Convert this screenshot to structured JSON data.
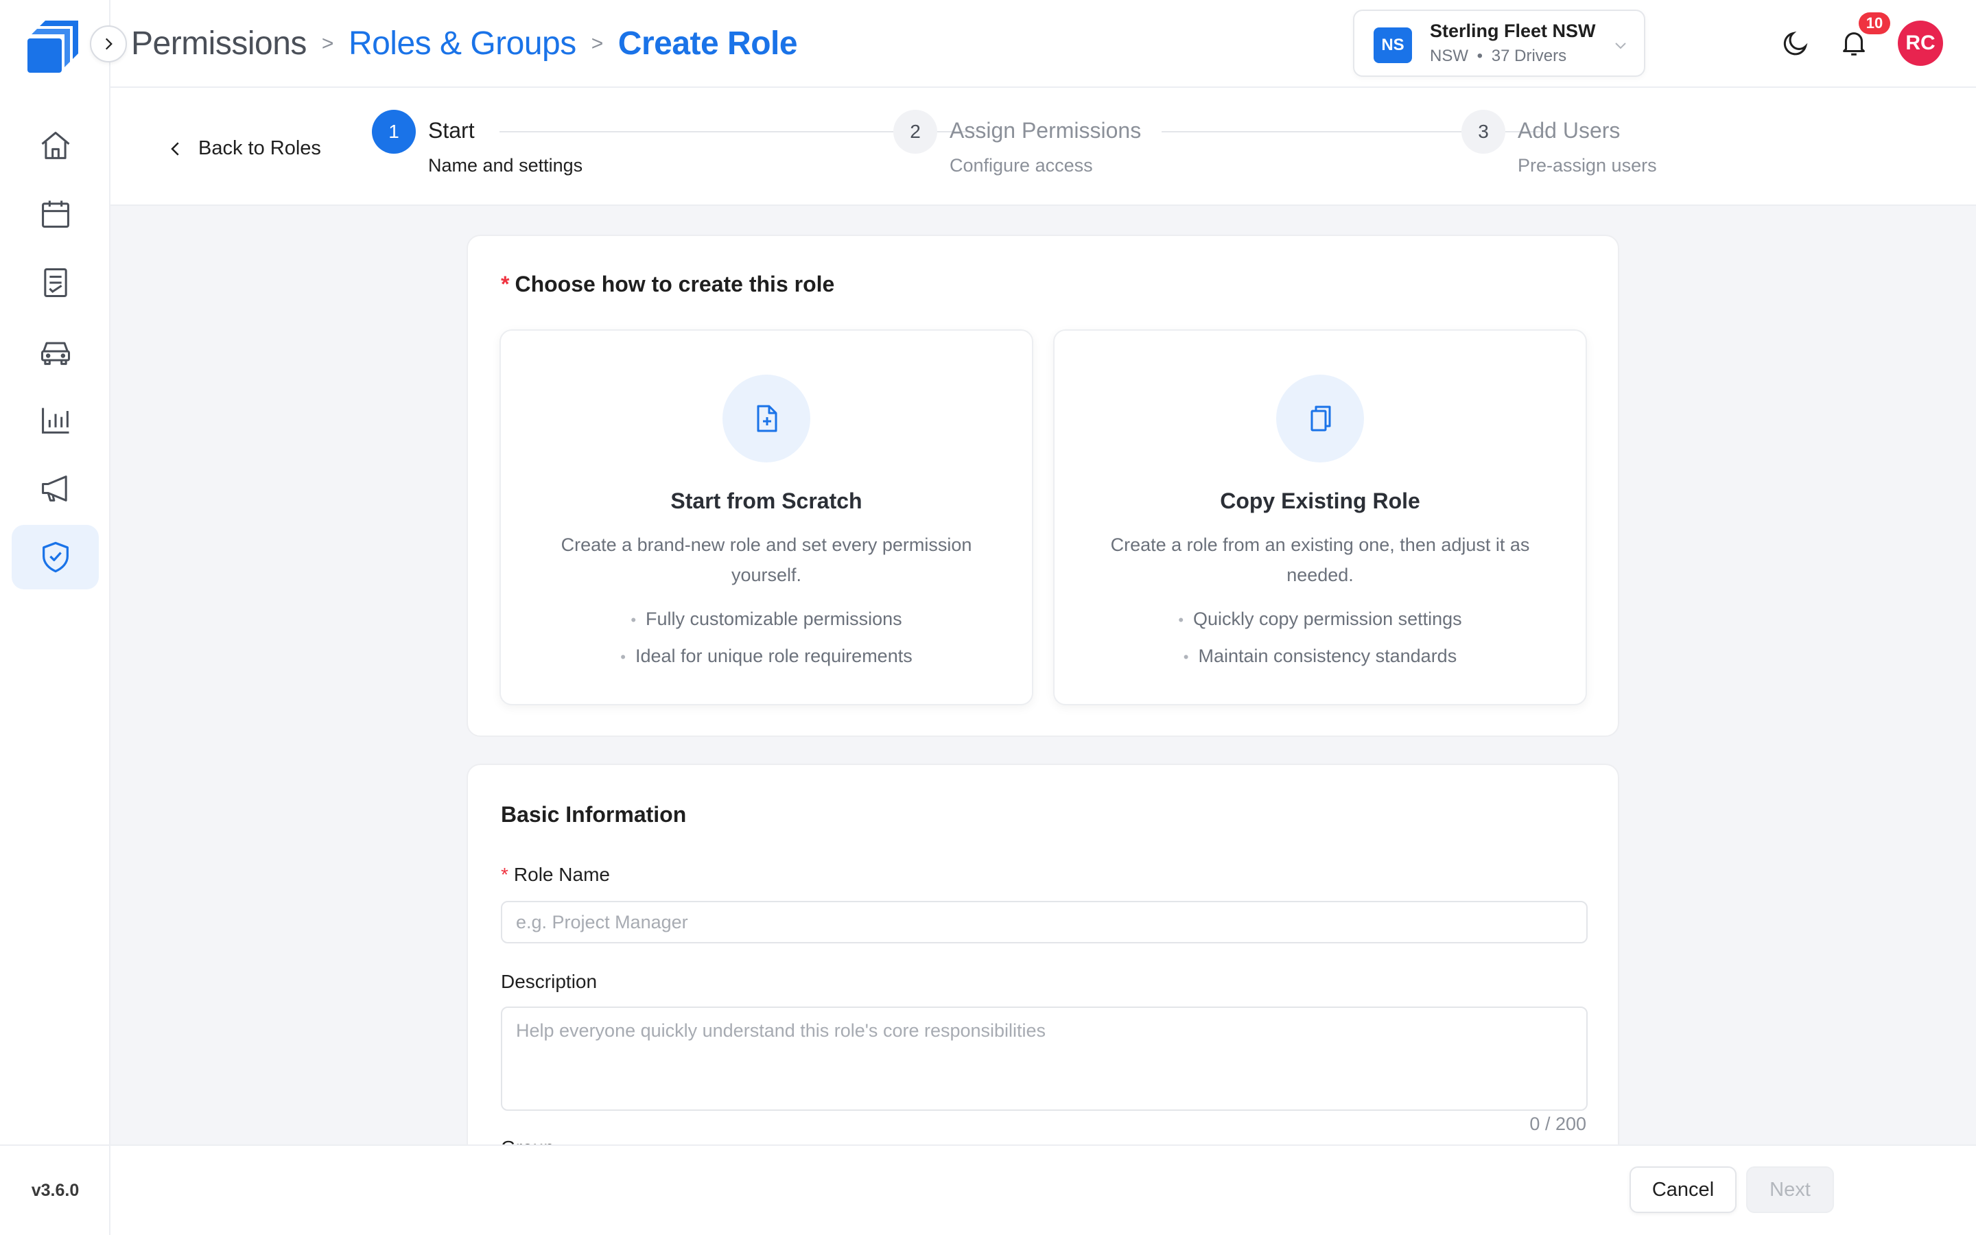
{
  "app": {
    "version": "v3.6.0"
  },
  "breadcrumb": {
    "items": [
      "Permissions",
      "Roles & Groups",
      "Create Role"
    ],
    "separator": ">"
  },
  "org": {
    "initials": "NS",
    "name": "Sterling Fleet NSW",
    "region": "NSW",
    "meta_sep": "•",
    "drivers": "37 Drivers"
  },
  "notifications": {
    "count": "10"
  },
  "user": {
    "initials": "RC"
  },
  "sidebar": {
    "items": [
      {
        "name": "home",
        "icon": "home-icon",
        "active": false
      },
      {
        "name": "calendar",
        "icon": "calendar-icon",
        "active": false
      },
      {
        "name": "documents",
        "icon": "document-list-icon",
        "active": false
      },
      {
        "name": "vehicles",
        "icon": "car-icon",
        "active": false
      },
      {
        "name": "reports",
        "icon": "bar-chart-icon",
        "active": false
      },
      {
        "name": "announcements",
        "icon": "megaphone-icon",
        "active": false
      },
      {
        "name": "permissions",
        "icon": "shield-check-icon",
        "active": true
      }
    ]
  },
  "stepper": {
    "back_label": "Back to Roles",
    "steps": [
      {
        "num": "1",
        "title": "Start",
        "subtitle": "Name and settings",
        "active": true
      },
      {
        "num": "2",
        "title": "Assign Permissions",
        "subtitle": "Configure access",
        "active": false
      },
      {
        "num": "3",
        "title": "Add Users",
        "subtitle": "Pre-assign users",
        "active": false
      }
    ]
  },
  "creation": {
    "required_mark": "*",
    "title": "Choose how to create this role",
    "options": [
      {
        "icon": "file-plus-icon",
        "title": "Start from Scratch",
        "description": "Create a brand-new role and set every permission yourself.",
        "bullets": [
          "Fully customizable permissions",
          "Ideal for unique role requirements"
        ]
      },
      {
        "icon": "copy-icon",
        "title": "Copy Existing Role",
        "description": "Create a role from an existing one, then adjust it as needed.",
        "bullets": [
          "Quickly copy permission settings",
          "Maintain consistency standards"
        ]
      }
    ]
  },
  "basic_info": {
    "title": "Basic Information",
    "role_name": {
      "required_mark": "*",
      "label": "Role Name",
      "value": "",
      "placeholder": "e.g. Project Manager"
    },
    "description": {
      "label": "Description",
      "value": "",
      "placeholder": "Help everyone quickly understand this role's core responsibilities",
      "char_count": "0 / 200"
    },
    "group_label": "Group"
  },
  "footer": {
    "cancel_label": "Cancel",
    "next_label": "Next"
  },
  "colors": {
    "accent": "#1a73e8",
    "danger": "#ef3340",
    "avatar": "#e8244f"
  }
}
